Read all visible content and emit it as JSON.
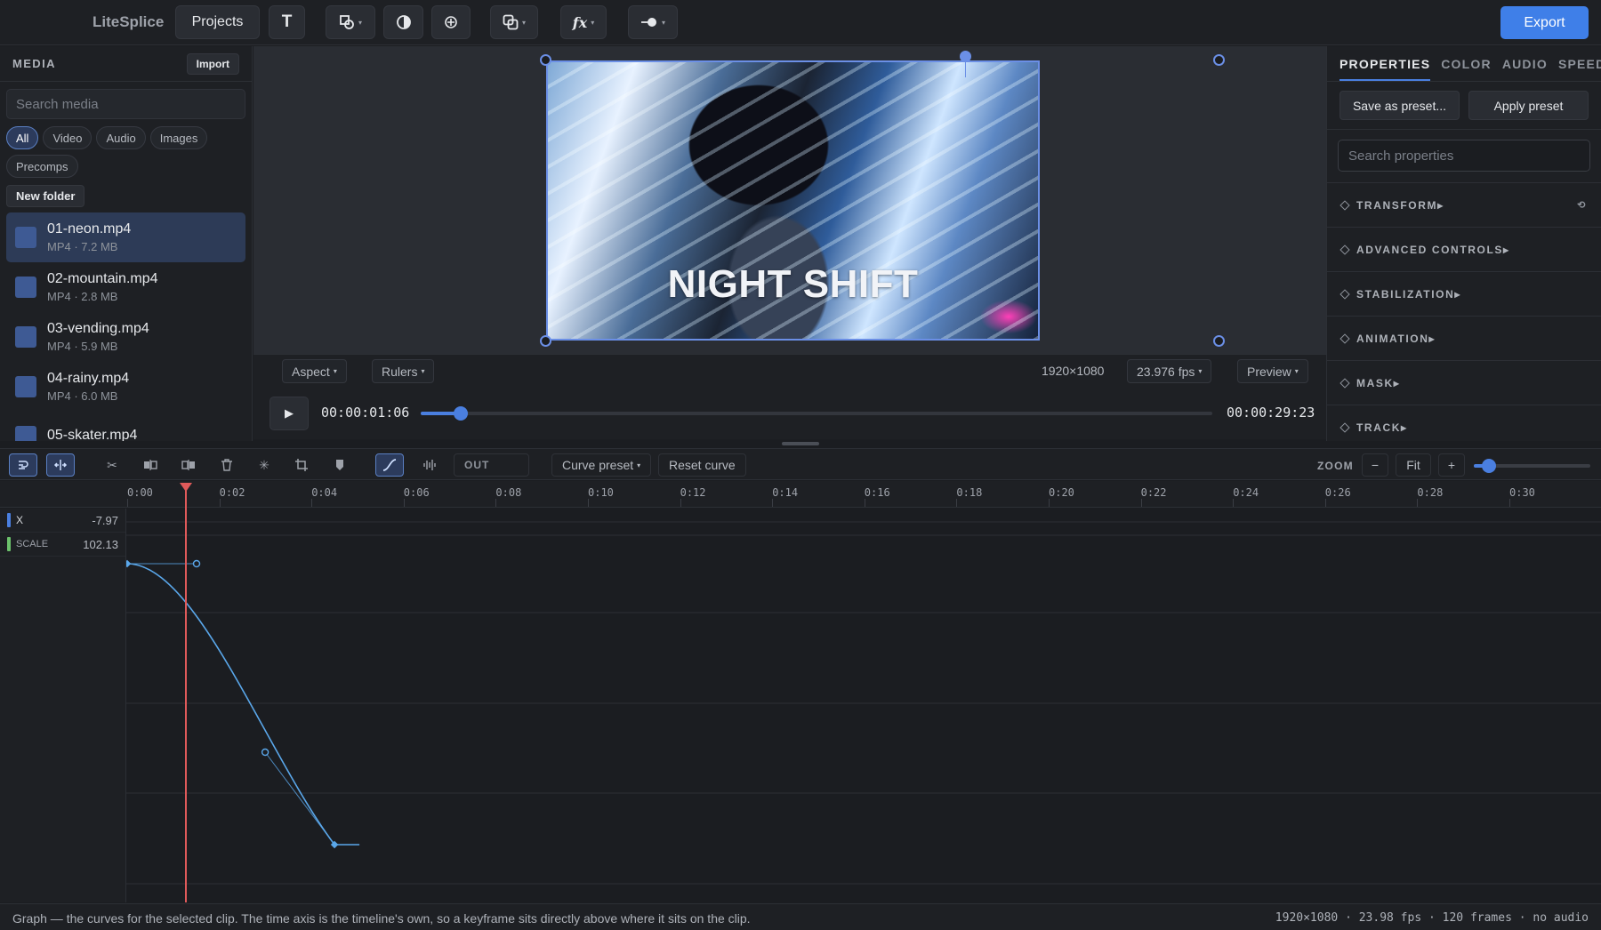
{
  "app": {
    "title": "LiteSplice",
    "projects_label": "Projects",
    "export_label": "Export"
  },
  "toolbar_icons": [
    "text-icon",
    "shapes-icon",
    "contrast-icon",
    "target-icon",
    "overlap-icon",
    "fx-icon",
    "toggle-icon"
  ],
  "media": {
    "header": "MEDIA",
    "import_label": "Import",
    "search_placeholder": "Search media",
    "filters": [
      {
        "label": "All",
        "active": true
      },
      {
        "label": "Video"
      },
      {
        "label": "Audio"
      },
      {
        "label": "Images"
      },
      {
        "label": "Precomps"
      }
    ],
    "new_folder_label": "New folder",
    "items": [
      {
        "name": "01-neon.mp4",
        "meta": "MP4 · 7.2 MB",
        "selected": true
      },
      {
        "name": "02-mountain.mp4",
        "meta": "MP4 · 2.8 MB"
      },
      {
        "name": "03-vending.mp4",
        "meta": "MP4 · 5.9 MB"
      },
      {
        "name": "04-rainy.mp4",
        "meta": "MP4 · 6.0 MB"
      },
      {
        "name": "05-skater.mp4",
        "meta": ""
      }
    ]
  },
  "preview": {
    "overlay_title": "NIGHT SHIFT",
    "aspect_label": "Aspect",
    "rulers_label": "Rulers",
    "resolution": "1920×1080",
    "fps_label": "23.976 fps",
    "preview_label": "Preview"
  },
  "transport": {
    "current_time": "00:00:01:06",
    "total_time": "00:00:29:23",
    "progress": 0.05
  },
  "properties": {
    "tabs": [
      {
        "label": "PROPERTIES",
        "active": true
      },
      {
        "label": "COLOR"
      },
      {
        "label": "AUDIO"
      },
      {
        "label": "SPEED"
      }
    ],
    "save_preset_label": "Save as preset...",
    "apply_preset_label": "Apply preset",
    "search_placeholder": "Search properties",
    "sections": [
      "TRANSFORM",
      "ADVANCED CONTROLS",
      "STABILIZATION",
      "ANIMATION",
      "MASK",
      "TRACK"
    ]
  },
  "timeline_toolbar": {
    "easing_out_label": "OUT",
    "curve_preset_label": "Curve preset",
    "reset_curve_label": "Reset curve",
    "zoom_label": "ZOOM",
    "zoom_minus": "−",
    "zoom_fit": "Fit",
    "zoom_plus": "+",
    "zoom_level": 0.13
  },
  "ruler": {
    "labels": [
      "0:00",
      "0:02",
      "0:04",
      "0:06",
      "0:08",
      "0:10",
      "0:12",
      "0:14",
      "0:16",
      "0:18",
      "0:20",
      "0:22",
      "0:24",
      "0:26",
      "0:28",
      "0:30"
    ],
    "playhead_seconds": 1.25
  },
  "channels": [
    {
      "name": "X",
      "value": "-7.97",
      "color": "#4a7fe0"
    },
    {
      "name": "SCALE",
      "value": "102.13",
      "color": "#6cc26c"
    }
  ],
  "graph": {
    "keyframes_seconds": [
      0,
      4.5
    ],
    "curve_color": "#5aa7ea"
  },
  "status": {
    "message": "Graph — the curves for the selected clip. The time axis is the timeline's own, so a keyframe sits directly above where it sits on the clip.",
    "summary": "1920×1080 · 23.98 fps · 120 frames · no audio"
  }
}
